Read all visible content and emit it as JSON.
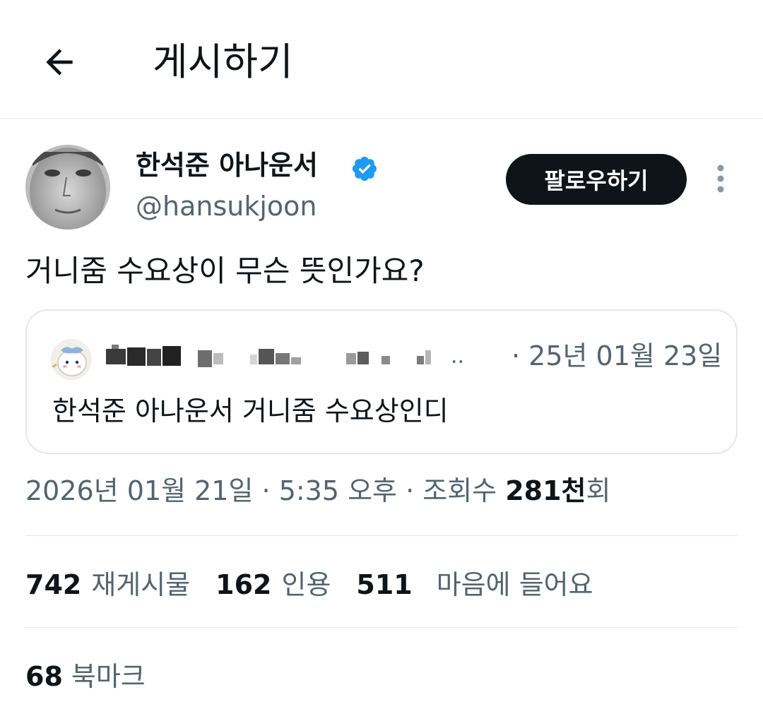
{
  "header": {
    "title": "게시하기",
    "back_icon": "arrow-left-icon"
  },
  "author": {
    "display_name": "한석준 아나운서",
    "handle": "@hansukjoon",
    "verified": true,
    "verified_color": "#1d9bf0",
    "follow_label": "팔로우하기",
    "more_icon": "more-vertical-icon"
  },
  "post": {
    "text": "거니줌 수요상이 무슨 뜻인가요?",
    "timestamp": "2026년 01월 21일 · 5:35 오후 · 조회수 ",
    "views_count": "281천",
    "views_suffix": "회"
  },
  "quote": {
    "ellipsis": "..",
    "date": "· 25년 01월 23일",
    "text": "한석준 아나운서 거니줌 수요상인디"
  },
  "stats": {
    "reposts_count": "742",
    "reposts_label": "재게시물",
    "quotes_count": "162",
    "quotes_label": "인용",
    "likes_count": "511",
    "likes_label": "마음에 들어요",
    "bookmarks_count": "68",
    "bookmarks_label": "북마크"
  },
  "colors": {
    "text_primary": "#0f1419",
    "text_secondary": "#536471",
    "border": "#e4e6e8",
    "button_bg": "#0f1419"
  }
}
